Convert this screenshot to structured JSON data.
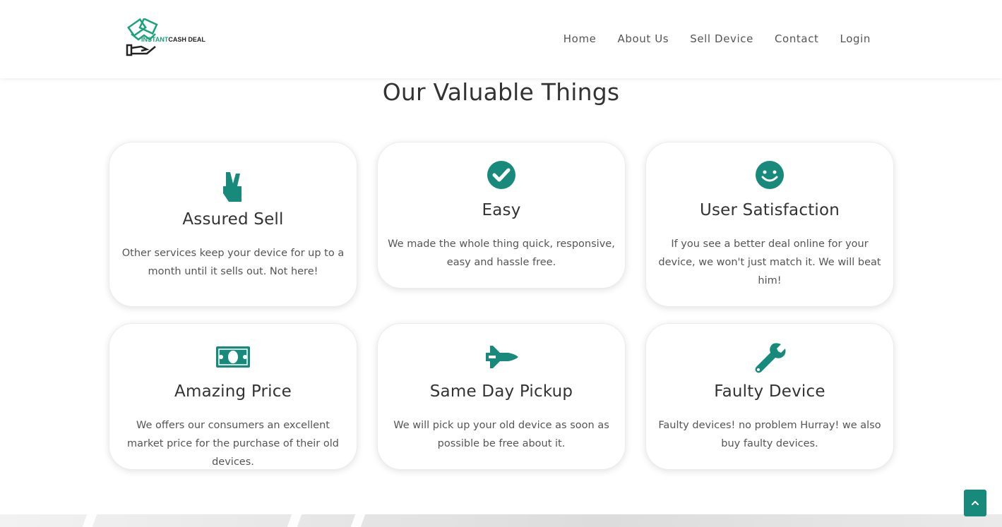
{
  "brand": {
    "logo_text_part1": "INSTANT",
    "logo_text_part2": "CASH DEAL",
    "accent_color": "#178a7c"
  },
  "nav": {
    "items": [
      {
        "label": "Home"
      },
      {
        "label": "About Us"
      },
      {
        "label": "Sell Device"
      },
      {
        "label": "Contact"
      },
      {
        "label": "Login"
      }
    ]
  },
  "section": {
    "title": "Our Valuable Things"
  },
  "cards": [
    {
      "icon": "victory-hand-icon",
      "title": "Assured Sell",
      "text": "Other services keep your device for up to a month until it sells out. Not here!"
    },
    {
      "icon": "check-circle-icon",
      "title": "Easy",
      "text": "We made the whole thing quick, responsive, easy and hassle free."
    },
    {
      "icon": "smile-icon",
      "title": "User Satisfaction",
      "text": "If you see a better deal online for your device, we won't just match it. We will beat him!"
    },
    {
      "icon": "money-bill-icon",
      "title": "Amazing Price",
      "text": "We offers our consumers an excellent market price for the purchase of their old devices."
    },
    {
      "icon": "space-shuttle-icon",
      "title": "Same Day Pickup",
      "text": "We will pick up your old device as soon as possible be free about it."
    },
    {
      "icon": "wrench-icon",
      "title": "Faulty Device",
      "text": "Faulty devices! no problem Hurray! we also buy faulty devices."
    }
  ],
  "scroll_top": {
    "icon": "chevron-up-icon"
  }
}
